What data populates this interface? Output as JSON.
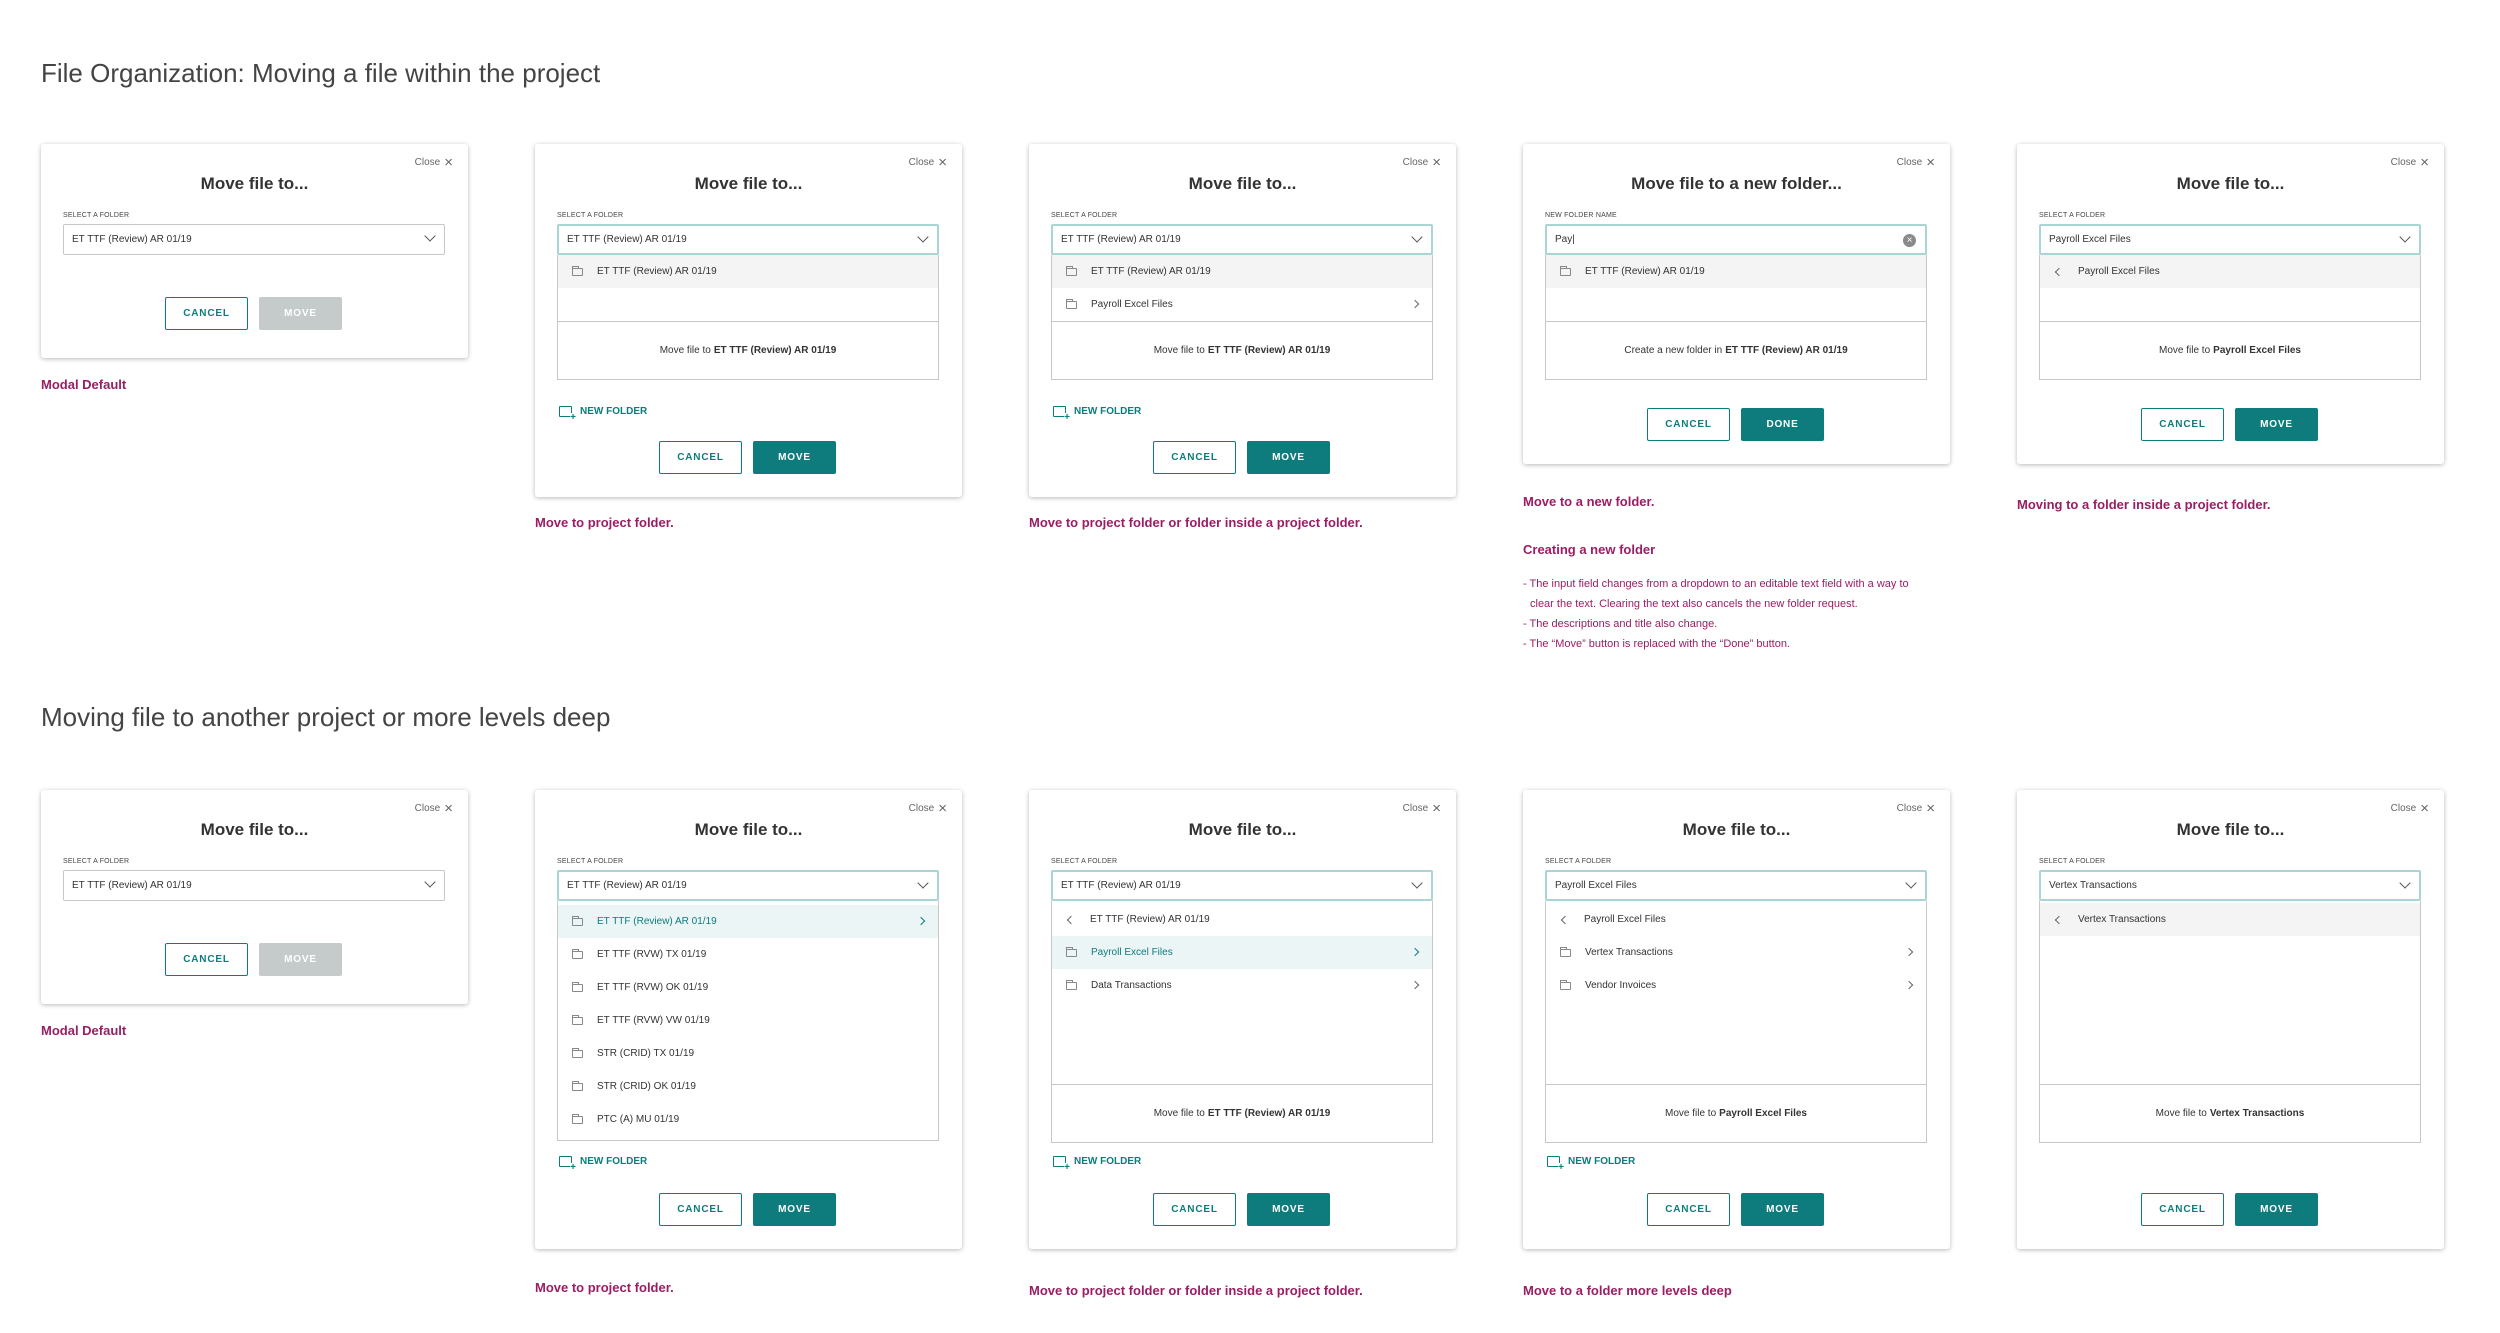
{
  "section1": {
    "title": "File Organization: Moving a file within the project"
  },
  "section2": {
    "title": "Moving file to another project or more levels deep"
  },
  "common": {
    "close": "Close",
    "close_icon": "close-icon",
    "cancel": "CANCEL",
    "move": "MOVE",
    "done": "DONE",
    "new_folder": "NEW FOLDER",
    "select_label": "SELECT A FOLDER",
    "new_folder_label": "NEW FOLDER NAME",
    "move_file_to": "Move file to",
    "accent_color": "#0e7c7c",
    "caption_color": "#9b1d63"
  },
  "r1": {
    "c1": {
      "title": "Move file to...",
      "value": "ET TTF (Review) AR 01/19",
      "caption": "Modal Default"
    },
    "c2": {
      "title": "Move file to...",
      "value": "ET TTF (Review) AR 01/19",
      "options": [
        "ET TTF (Review) AR 01/19"
      ],
      "target": "ET TTF (Review) AR 01/19",
      "caption": "Move to project folder."
    },
    "c3": {
      "title": "Move file to...",
      "value": "ET TTF (Review) AR 01/19",
      "options": [
        "ET TTF (Review) AR 01/19",
        "Payroll Excel Files"
      ],
      "target": "ET TTF (Review) AR 01/19",
      "caption": "Move to project folder or folder inside a project folder."
    },
    "c4": {
      "title": "Move file to a new folder...",
      "value": "Pay|",
      "options": [
        "ET TTF (Review) AR 01/19"
      ],
      "create_text": "Create a new folder in",
      "target": "ET TTF (Review) AR 01/19",
      "caption": "Move to a new folder.",
      "caption2": "Creating a new folder",
      "notes": [
        "- The input field changes from a dropdown to an editable text field with a way to",
        "  clear the text. Clearing the text also cancels the new folder request.",
        "- The descriptions and title also change.",
        "- The “Move” button is replaced with the “Done” button."
      ]
    },
    "c5": {
      "title": "Move file to...",
      "value": "Payroll Excel Files",
      "options": [
        "Payroll Excel Files"
      ],
      "target": "Payroll Excel Files",
      "caption": "Moving to a folder inside a project folder."
    }
  },
  "r2": {
    "c1": {
      "title": "Move file to...",
      "value": "ET TTF (Review) AR 01/19",
      "caption": "Modal Default"
    },
    "c2": {
      "title": "Move file to...",
      "value": "ET TTF (Review) AR 01/19",
      "options": [
        "ET TTF (Review) AR 01/19",
        "ET TTF (RVW) TX 01/19",
        "ET TTF (RVW) OK 01/19",
        "ET TTF (RVW) VW 01/19",
        "STR (CRID) TX 01/19",
        "STR (CRID) OK 01/19",
        "PTC (A) MU 01/19"
      ],
      "caption": "Move to project folder."
    },
    "c3": {
      "title": "Move file to...",
      "value": "ET TTF (Review) AR 01/19",
      "options": [
        "ET TTF (Review) AR 01/19",
        "Payroll Excel Files",
        "Data Transactions"
      ],
      "target": "ET TTF (Review) AR 01/19",
      "caption": "Move to project folder or folder inside a project folder."
    },
    "c4": {
      "title": "Move file to...",
      "value": "Payroll Excel Files",
      "options": [
        "Payroll Excel Files",
        "Vertex Transactions",
        "Vendor Invoices"
      ],
      "target": "Payroll Excel Files",
      "caption": "Move to a folder more levels deep"
    },
    "c5": {
      "title": "Move file to...",
      "value": "Vertex Transactions",
      "options": [
        "Vertex Transactions"
      ],
      "target": "Vertex Transactions"
    }
  }
}
